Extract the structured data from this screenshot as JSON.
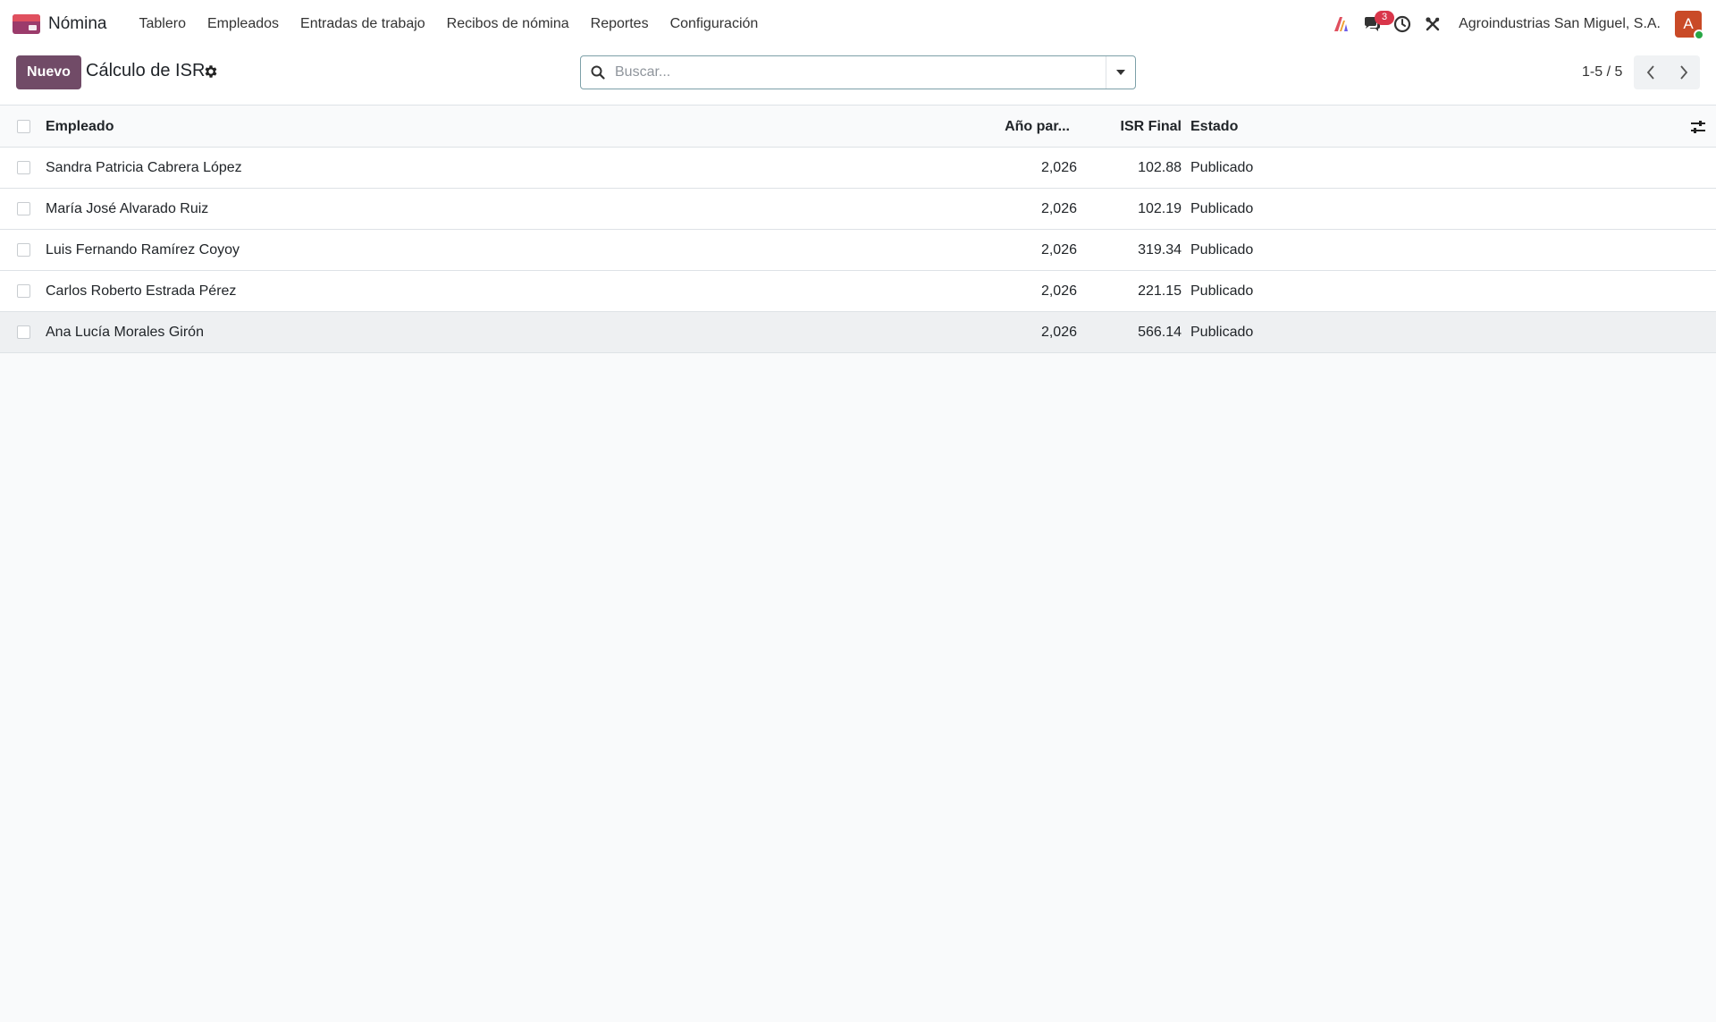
{
  "navbar": {
    "app_name": "Nómina",
    "menu": [
      "Tablero",
      "Empleados",
      "Entradas de trabajo",
      "Recibos de nómina",
      "Reportes",
      "Configuración"
    ],
    "messages_badge": "3",
    "company": "Agroindustrias San Miguel, S.A.",
    "avatar_initial": "A"
  },
  "control_panel": {
    "new_label": "Nuevo",
    "title": "Cálculo de ISR",
    "search_placeholder": "Buscar...",
    "pager": "1-5 / 5"
  },
  "table": {
    "headers": {
      "employee": "Empleado",
      "year": "Año par...",
      "isr": "ISR Final",
      "state": "Estado"
    },
    "rows": [
      {
        "employee": "Sandra Patricia Cabrera López",
        "year": "2,026",
        "isr": "102.88",
        "state": "Publicado"
      },
      {
        "employee": "María José Alvarado Ruiz",
        "year": "2,026",
        "isr": "102.19",
        "state": "Publicado"
      },
      {
        "employee": "Luis Fernando Ramírez Coyoy",
        "year": "2,026",
        "isr": "319.34",
        "state": "Publicado"
      },
      {
        "employee": "Carlos Roberto Estrada Pérez",
        "year": "2,026",
        "isr": "221.15",
        "state": "Publicado"
      },
      {
        "employee": "Ana Lucía Morales Girón",
        "year": "2,026",
        "isr": "566.14",
        "state": "Publicado"
      }
    ]
  },
  "colors": {
    "brand": "#714b67",
    "badge": "#d9364a",
    "avatar": "#c94a27"
  }
}
